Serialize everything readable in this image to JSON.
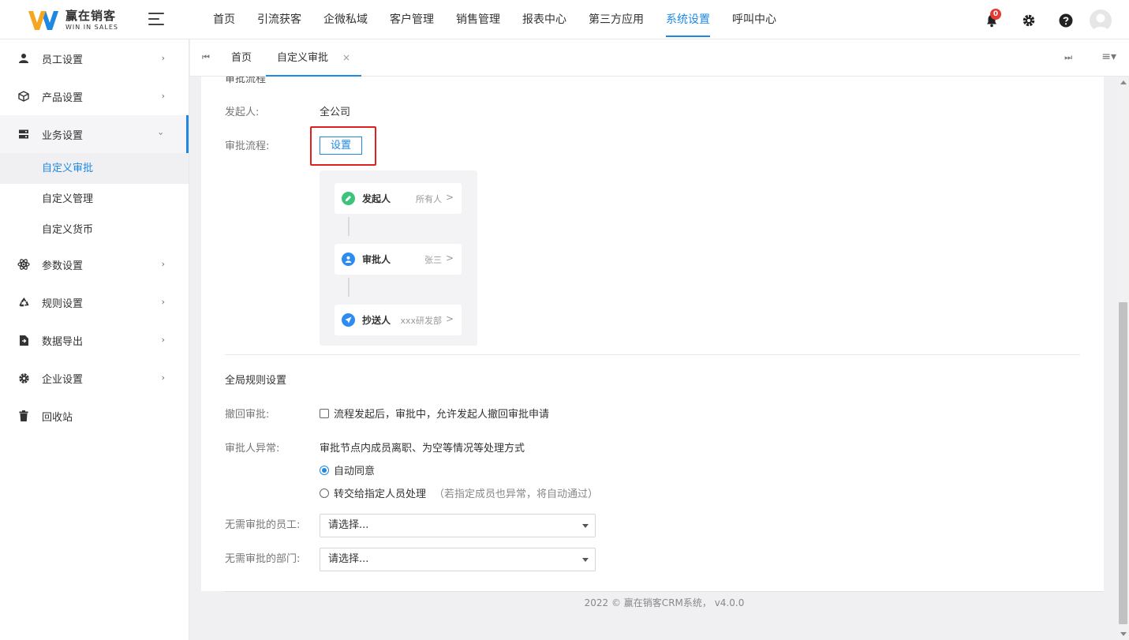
{
  "brand": {
    "name_cn": "赢在销客",
    "name_en": "WIN IN SALES",
    "color_primary": "#1e88e5"
  },
  "topnav": [
    {
      "label": "首页"
    },
    {
      "label": "引流获客"
    },
    {
      "label": "企微私域"
    },
    {
      "label": "客户管理"
    },
    {
      "label": "销售管理"
    },
    {
      "label": "报表中心"
    },
    {
      "label": "第三方应用"
    },
    {
      "label": "系统设置",
      "active": true
    },
    {
      "label": "呼叫中心"
    }
  ],
  "header": {
    "notification_count": "0"
  },
  "sidebar": {
    "items": [
      {
        "label": "员工设置",
        "icon": "user-icon"
      },
      {
        "label": "产品设置",
        "icon": "cube-icon"
      },
      {
        "label": "业务设置",
        "icon": "server-icon",
        "open": true
      },
      {
        "label": "参数设置",
        "icon": "atom-icon"
      },
      {
        "label": "规则设置",
        "icon": "recycle-icon"
      },
      {
        "label": "数据导出",
        "icon": "file-export-icon"
      },
      {
        "label": "企业设置",
        "icon": "gear-icon"
      },
      {
        "label": "回收站",
        "icon": "trash-icon"
      }
    ],
    "sub": [
      {
        "label": "自定义审批",
        "active": true
      },
      {
        "label": "自定义管理"
      },
      {
        "label": "自定义货币"
      }
    ]
  },
  "tabs": {
    "home": "首页",
    "current": "自定义审批",
    "close": "×"
  },
  "approval": {
    "section_cut": "审批流程",
    "initiator_label": "发起人:",
    "initiator_value": "全公司",
    "flow_label": "审批流程:",
    "set_button": "设置",
    "nodes": [
      {
        "label": "发起人",
        "value": "所有人",
        "color": "#3cc47c"
      },
      {
        "label": "审批人",
        "value": "张三",
        "color": "#2d8cf0"
      },
      {
        "label": "抄送人",
        "value": "xxx研发部",
        "color": "#2d8cf0"
      }
    ]
  },
  "global_rules": {
    "title": "全局规则设置",
    "withdraw_label": "撤回审批:",
    "withdraw_text": "流程发起后，审批中，允许发起人撤回审批申请",
    "exception_label": "审批人异常:",
    "exception_desc": "审批节点内成员离职、为空等情况等处理方式",
    "option_auto": "自动同意",
    "option_transfer": "转交给指定人员处理",
    "option_transfer_note": "（若指定成员也异常，将自动通过）",
    "no_approval_staff_label": "无需审批的员工:",
    "no_approval_dept_label": "无需审批的部门:",
    "select_placeholder": "请选择..."
  },
  "footer": {
    "text": "2022 © 赢在销客CRM系统， v4.0.0"
  }
}
